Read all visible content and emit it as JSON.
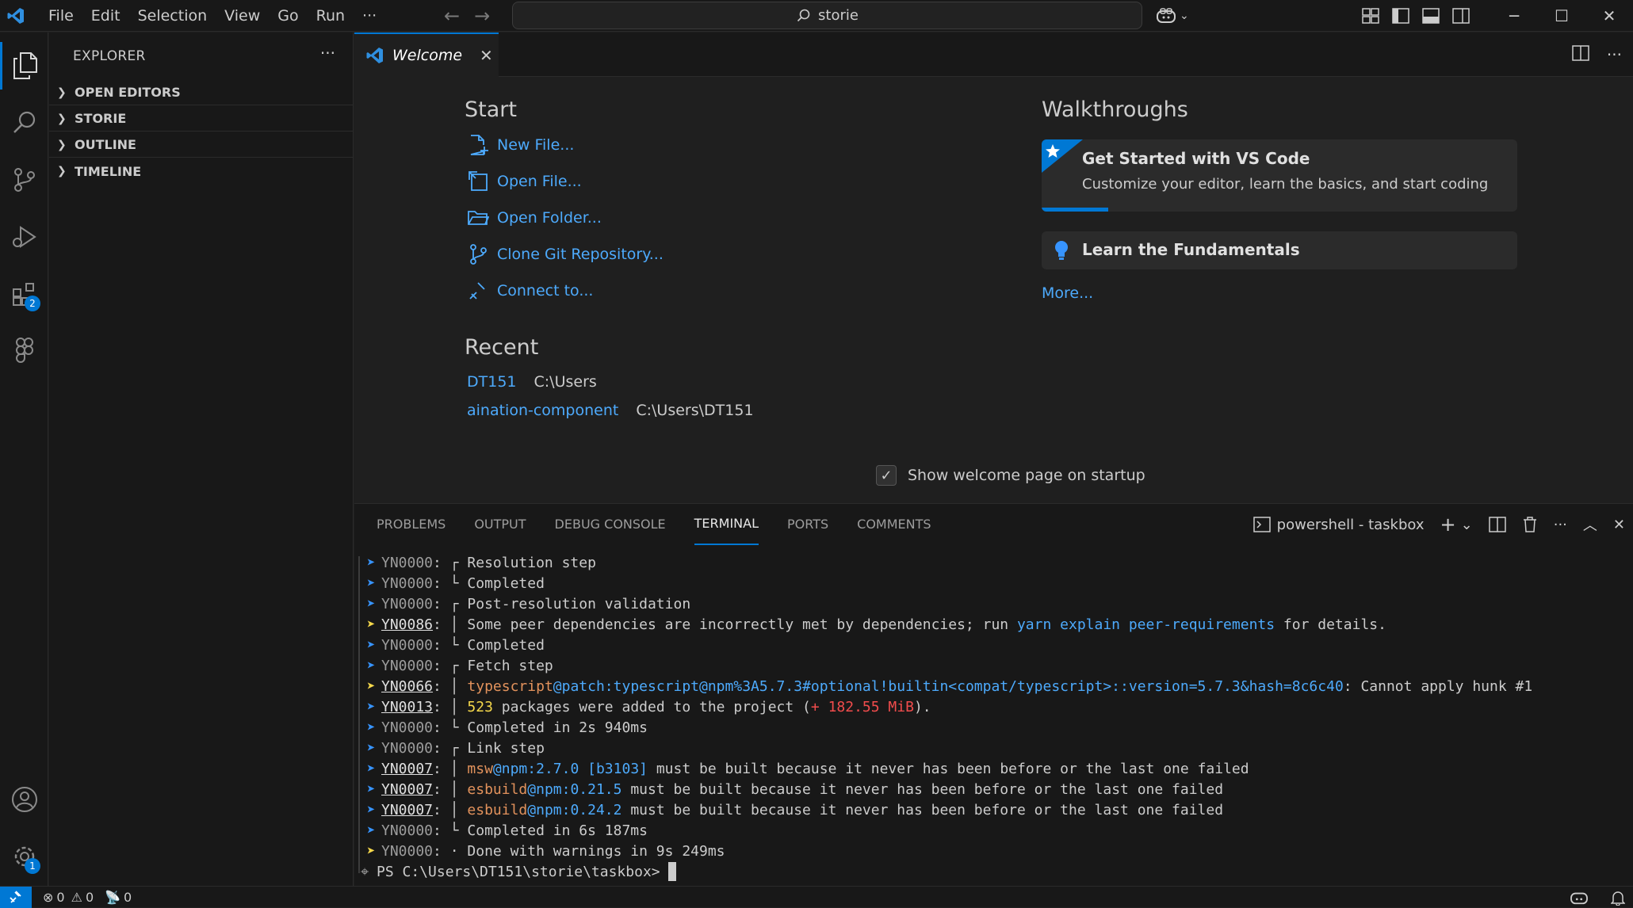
{
  "titlebar": {
    "menu": [
      "File",
      "Edit",
      "Selection",
      "View",
      "Go",
      "Run",
      "···"
    ],
    "search": "storie"
  },
  "activity": {
    "extensions_badge": "2",
    "manage_badge": "1"
  },
  "sidebar": {
    "title": "EXPLORER",
    "sections": [
      "OPEN EDITORS",
      "STORIE",
      "OUTLINE",
      "TIMELINE"
    ]
  },
  "editor": {
    "tab": "Welcome",
    "start_heading": "Start",
    "start_items": [
      "New File...",
      "Open File...",
      "Open Folder...",
      "Clone Git Repository...",
      "Connect to..."
    ],
    "recent_heading": "Recent",
    "recent": [
      {
        "name": "DT151",
        "path": "C:\\Users"
      },
      {
        "name": "aination-component",
        "path": "C:\\Users\\DT151"
      }
    ],
    "walk_heading": "Walkthroughs",
    "walk1_title": "Get Started with VS Code",
    "walk1_desc": "Customize your editor, learn the basics, and start coding",
    "walk1_progress": 0.14,
    "walk2_title": "Learn the Fundamentals",
    "more": "More...",
    "startup_label": "Show welcome page on startup"
  },
  "panel": {
    "tabs": [
      "PROBLEMS",
      "OUTPUT",
      "DEBUG CONSOLE",
      "TERMINAL",
      "PORTS",
      "COMMENTS"
    ],
    "terminal_name": "powershell - taskbox"
  },
  "terminal": {
    "lines": [
      {
        "code": "YN0000",
        "u": false,
        "y": false,
        "segs": [
          [
            "┌ Resolution step",
            ""
          ]
        ]
      },
      {
        "code": "YN0000",
        "u": false,
        "y": false,
        "segs": [
          [
            "└ Completed",
            ""
          ]
        ]
      },
      {
        "code": "YN0000",
        "u": false,
        "y": false,
        "segs": [
          [
            "┌ Post-resolution validation",
            ""
          ]
        ]
      },
      {
        "code": "YN0086",
        "u": true,
        "y": true,
        "segs": [
          [
            "│ Some peer dependencies are incorrectly met by dependencies; run ",
            ""
          ],
          [
            "yarn explain peer-requirements",
            "t-blue"
          ],
          [
            " for details.",
            ""
          ]
        ]
      },
      {
        "code": "YN0000",
        "u": false,
        "y": false,
        "segs": [
          [
            "└ Completed",
            ""
          ]
        ]
      },
      {
        "code": "YN0000",
        "u": false,
        "y": false,
        "segs": [
          [
            "┌ Fetch step",
            ""
          ]
        ]
      },
      {
        "code": "YN0066",
        "u": true,
        "y": true,
        "segs": [
          [
            "│ ",
            ""
          ],
          [
            "typescript",
            "t-orange"
          ],
          [
            "@patch:typescript@npm%3A5.7.3#optional!builtin<compat/typescript>::version=5.7.3&hash=8c6c40",
            "t-blue"
          ],
          [
            ": Cannot apply hunk #1",
            ""
          ]
        ]
      },
      {
        "code": "YN0013",
        "u": true,
        "y": false,
        "segs": [
          [
            "│ ",
            ""
          ],
          [
            "523",
            "t-yellow"
          ],
          [
            " packages were added to the project (",
            ""
          ],
          [
            "+ 182.55 MiB",
            "t-red"
          ],
          [
            ").",
            ""
          ]
        ]
      },
      {
        "code": "YN0000",
        "u": false,
        "y": false,
        "segs": [
          [
            "└ Completed in 2s 940ms",
            ""
          ]
        ]
      },
      {
        "code": "YN0000",
        "u": false,
        "y": false,
        "segs": [
          [
            "┌ Link step",
            ""
          ]
        ]
      },
      {
        "code": "YN0007",
        "u": true,
        "y": false,
        "segs": [
          [
            "│ ",
            ""
          ],
          [
            "msw",
            "t-orange"
          ],
          [
            "@npm:2.7.0 [b3103]",
            "t-blue"
          ],
          [
            " must be built because it never has been before or the last one failed",
            ""
          ]
        ]
      },
      {
        "code": "YN0007",
        "u": true,
        "y": false,
        "segs": [
          [
            "│ ",
            ""
          ],
          [
            "esbuild",
            "t-orange"
          ],
          [
            "@npm:0.21.5",
            "t-blue"
          ],
          [
            " must be built because it never has been before or the last one failed",
            ""
          ]
        ]
      },
      {
        "code": "YN0007",
        "u": true,
        "y": false,
        "segs": [
          [
            "│ ",
            ""
          ],
          [
            "esbuild",
            "t-orange"
          ],
          [
            "@npm:0.24.2",
            "t-blue"
          ],
          [
            " must be built because it never has been before or the last one failed",
            ""
          ]
        ]
      },
      {
        "code": "YN0000",
        "u": false,
        "y": false,
        "segs": [
          [
            "└ Completed in 6s 187ms",
            ""
          ]
        ]
      },
      {
        "code": "YN0000",
        "u": false,
        "y": true,
        "segs": [
          [
            "· Done with warnings in 9s 249ms",
            ""
          ]
        ]
      }
    ],
    "prompt": "PS C:\\Users\\DT151\\storie\\taskbox> "
  },
  "status": {
    "errors": "0",
    "warnings": "0",
    "ports": "0"
  },
  "colors": {
    "accent": "#0078d4",
    "link": "#4daafc"
  }
}
